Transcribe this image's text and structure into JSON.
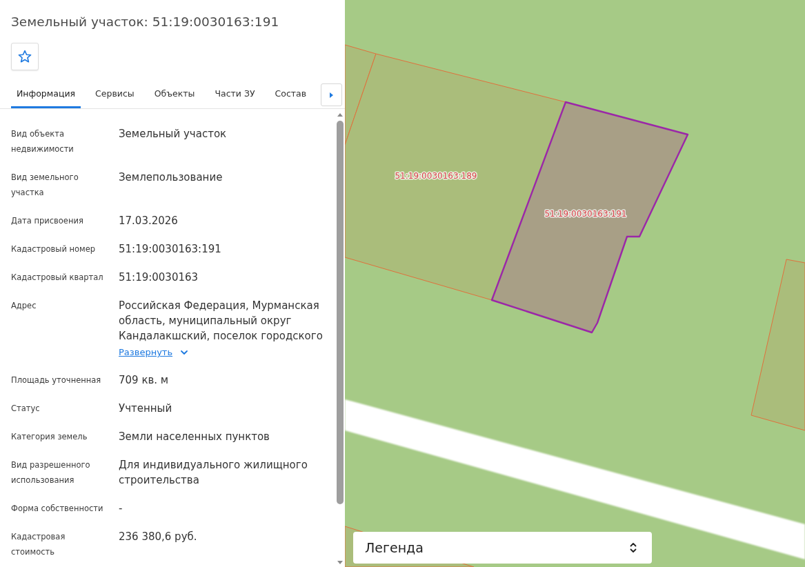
{
  "panel": {
    "title": "Земельный участок: 51:19:0030163:191",
    "starred": false
  },
  "tabs": [
    {
      "label": "Информация",
      "selected": true
    },
    {
      "label": "Сервисы",
      "selected": false
    },
    {
      "label": "Объекты",
      "selected": false
    },
    {
      "label": "Части ЗУ",
      "selected": false
    },
    {
      "label": "Состав",
      "selected": false
    }
  ],
  "details": [
    {
      "label": "Вид объекта недвижимости",
      "value": "Земельный участок"
    },
    {
      "label": "Вид земельного участка",
      "value": "Землепользование"
    },
    {
      "label": "Дата присвоения",
      "value": "17.03.2026"
    },
    {
      "label": "Кадастровый номер",
      "value": "51:19:0030163:191"
    },
    {
      "label": "Кадастровый квартал",
      "value": "51:19:0030163"
    },
    {
      "label": "Адрес",
      "value": "Российская Федерация, Мурманская область, муниципальный округ Кандалакшский, поселок городского",
      "expand_link": "Развернуть"
    },
    {
      "label": "Площадь уточненная",
      "value": "709 кв. м"
    },
    {
      "label": "Статус",
      "value": "Учтенный"
    },
    {
      "label": "Категория земель",
      "value": "Земли населенных пунктов"
    },
    {
      "label": "Вид разрешенного использования",
      "value": "Для индивидуального жилищного строительства"
    },
    {
      "label": "Форма собственности",
      "value": "-"
    },
    {
      "label": "Кадастровая стоимость",
      "value": "236 380,6 руб."
    }
  ],
  "map": {
    "parcels": [
      {
        "label": "51:19:0030163:189",
        "selected": false
      },
      {
        "label": "51:19:0030163:191",
        "selected": true
      }
    ],
    "legend": {
      "label": "Легенда"
    }
  }
}
